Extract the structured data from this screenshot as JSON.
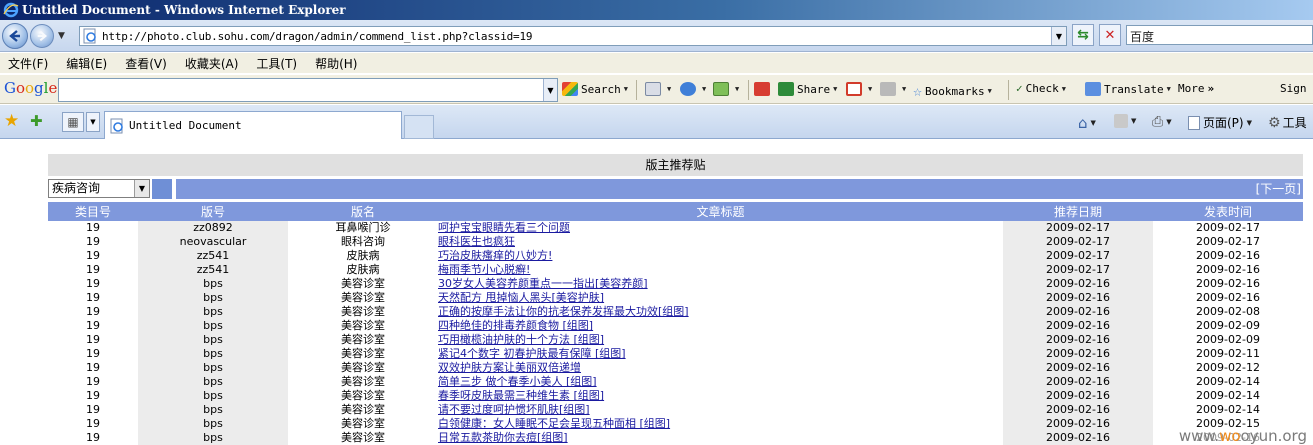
{
  "window": {
    "title": "Untitled Document - Windows Internet Explorer"
  },
  "address": {
    "url": "http://photo.club.sohu.com/dragon/admin/commend_list.php?classid=19"
  },
  "search_engine": {
    "value": "百度"
  },
  "menu": [
    "文件(F)",
    "编辑(E)",
    "查看(V)",
    "收藏夹(A)",
    "工具(T)",
    "帮助(H)"
  ],
  "google_toolbar": {
    "logo": "Google",
    "search_label": "Search",
    "share_label": "Share",
    "bookmarks_label": "Bookmarks",
    "check_label": "Check",
    "translate_label": "Translate",
    "more_label": "More",
    "signin_label": "Sign"
  },
  "tab": {
    "title": "Untitled Document"
  },
  "command_bar": {
    "page_label": "页面(P)",
    "tools_label": "工具"
  },
  "page": {
    "header": "版主推荐贴",
    "category_select": "疾病咨询",
    "next_page": "[下一页]",
    "columns": [
      "类目号",
      "版号",
      "版名",
      "文章标题",
      "推荐日期",
      "发表时间"
    ],
    "rows": [
      [
        "19",
        "zz0892",
        "耳鼻喉门诊",
        "呵护宝宝眼睛先看三个问题",
        "2009-02-17",
        "2009-02-17"
      ],
      [
        "19",
        "neovascular",
        "眼科咨询",
        "眼科医生也疯狂",
        "2009-02-17",
        "2009-02-17"
      ],
      [
        "19",
        "zz541",
        "皮肤病",
        "巧治皮肤瘙痒的八妙方!",
        "2009-02-17",
        "2009-02-16"
      ],
      [
        "19",
        "zz541",
        "皮肤病",
        "梅雨季节小心脱癣!",
        "2009-02-17",
        "2009-02-16"
      ],
      [
        "19",
        "bps",
        "美容诊室",
        "30岁女人美容养颜重点一一指出[美容养颜]",
        "2009-02-16",
        "2009-02-16"
      ],
      [
        "19",
        "bps",
        "美容诊室",
        "天然配方 甩掉恼人黑头[美容护肤]",
        "2009-02-16",
        "2009-02-16"
      ],
      [
        "19",
        "bps",
        "美容诊室",
        "正确的按摩手法让你的抗老保养发挥最大功效[组图]",
        "2009-02-16",
        "2009-02-08"
      ],
      [
        "19",
        "bps",
        "美容诊室",
        "四种绝佳的排毒养颜食物 [组图]",
        "2009-02-16",
        "2009-02-09"
      ],
      [
        "19",
        "bps",
        "美容诊室",
        "巧用橄榄油护肤的十个方法 [组图]",
        "2009-02-16",
        "2009-02-09"
      ],
      [
        "19",
        "bps",
        "美容诊室",
        "紧记4个数字 初春护肤最有保障 [组图]",
        "2009-02-16",
        "2009-02-11"
      ],
      [
        "19",
        "bps",
        "美容诊室",
        "双效护肤方案让美丽双倍递增",
        "2009-02-16",
        "2009-02-12"
      ],
      [
        "19",
        "bps",
        "美容诊室",
        "简单三步 做个春季小美人 [组图]",
        "2009-02-16",
        "2009-02-14"
      ],
      [
        "19",
        "bps",
        "美容诊室",
        "春季呀皮肤最需三种维生素 [组图]",
        "2009-02-16",
        "2009-02-14"
      ],
      [
        "19",
        "bps",
        "美容诊室",
        "请不要过度呵护惯坏肌肤[组图]",
        "2009-02-16",
        "2009-02-14"
      ],
      [
        "19",
        "bps",
        "美容诊室",
        "白领健康：女人睡眠不足会呈现五种面相 [组图]",
        "2009-02-16",
        "2009-02-15"
      ],
      [
        "19",
        "bps",
        "美容诊室",
        "日常五款茶助你去痘[组图]",
        "2009-02-16",
        "2009-02-16"
      ]
    ]
  },
  "watermark": {
    "prefix": "www.",
    "ring": "wo",
    "suffix": "oyun.org"
  }
}
